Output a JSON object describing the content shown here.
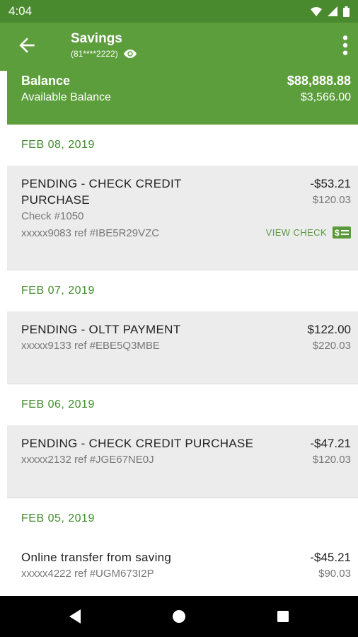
{
  "status": {
    "time": "4:04",
    "icons": [
      "wifi-icon",
      "signal-icon",
      "battery-icon"
    ]
  },
  "header": {
    "title": "Savings",
    "account_masked": "(81****2222)"
  },
  "balance": {
    "label": "Balance",
    "value": "$88,888.88",
    "available_label": "Available Balance",
    "available_value": "$3,566.00"
  },
  "groups": [
    {
      "date": "FEB 08, 2019",
      "items": [
        {
          "desc": "PENDING - CHECK CREDIT PURCHASE",
          "sub1": "Check #1050",
          "sub2": "xxxxx9083 ref #IBE5R29VZC",
          "amount": "-$53.21",
          "balance": "$120.03",
          "action": "VIEW CHECK"
        }
      ]
    },
    {
      "date": "FEB 07, 2019",
      "items": [
        {
          "desc": "PENDING - OLTT PAYMENT",
          "sub1": "xxxxx9133 ref #EBE5Q3MBE",
          "amount": "$122.00",
          "balance": "$220.03"
        }
      ]
    },
    {
      "date": "FEB 06, 2019",
      "items": [
        {
          "desc": "PENDING - CHECK CREDIT PURCHASE",
          "sub1": "xxxxx2132 ref #JGE67NE0J",
          "amount": "-$47.21",
          "balance": "$120.03"
        }
      ]
    },
    {
      "date": "FEB 05, 2019",
      "items": [
        {
          "desc": "Online transfer from saving",
          "sub1": "xxxxx4222 ref #UGM673I2P",
          "amount": "-$45.21",
          "balance": "$90.03"
        }
      ]
    }
  ],
  "colors": {
    "primary": "#5d9e3c",
    "status_bar": "#4a8a2e",
    "date_green": "#3f8b2a",
    "row_bg": "#ececec"
  }
}
